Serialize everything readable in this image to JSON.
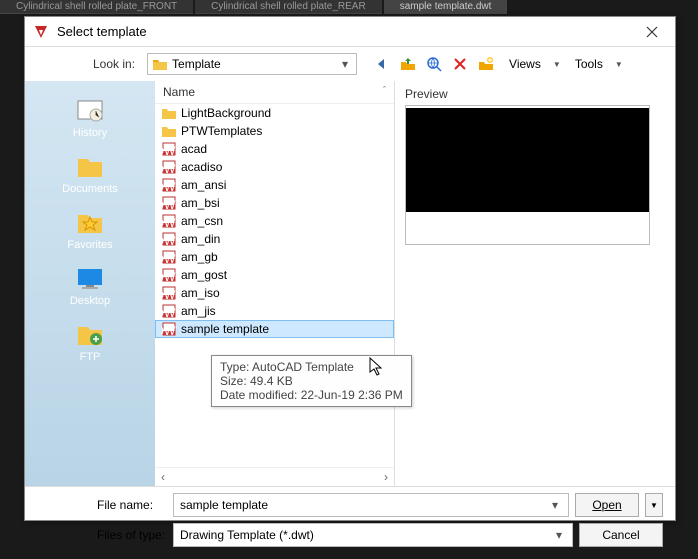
{
  "bg_tabs": [
    {
      "label": "Cylindrical shell rolled plate_FRONT",
      "active": false
    },
    {
      "label": "Cylindrical shell rolled plate_REAR",
      "active": false
    },
    {
      "label": "sample template.dwt",
      "active": true
    }
  ],
  "dialog": {
    "title": "Select template",
    "lookin_label": "Look in:",
    "lookin_value": "Template",
    "views_label": "Views",
    "tools_label": "Tools",
    "name_header": "Name",
    "preview_label": "Preview"
  },
  "sidebar": [
    {
      "label": "History",
      "icon": "history"
    },
    {
      "label": "Documents",
      "icon": "documents"
    },
    {
      "label": "Favorites",
      "icon": "favorites"
    },
    {
      "label": "Desktop",
      "icon": "desktop"
    },
    {
      "label": "FTP",
      "icon": "ftp"
    }
  ],
  "files": [
    {
      "name": "LightBackground",
      "type": "folder"
    },
    {
      "name": "PTWTemplates",
      "type": "folder"
    },
    {
      "name": "acad",
      "type": "dwt"
    },
    {
      "name": "acadiso",
      "type": "dwt"
    },
    {
      "name": "am_ansi",
      "type": "dwt"
    },
    {
      "name": "am_bsi",
      "type": "dwt"
    },
    {
      "name": "am_csn",
      "type": "dwt"
    },
    {
      "name": "am_din",
      "type": "dwt"
    },
    {
      "name": "am_gb",
      "type": "dwt"
    },
    {
      "name": "am_gost",
      "type": "dwt"
    },
    {
      "name": "am_iso",
      "type": "dwt"
    },
    {
      "name": "am_jis",
      "type": "dwt"
    },
    {
      "name": "sample template",
      "type": "dwt",
      "selected": true
    }
  ],
  "tooltip": {
    "type_line": "Type: AutoCAD Template",
    "size_line": "Size: 49.4 KB",
    "date_line": "Date modified: 22-Jun-19 2:36 PM"
  },
  "footer": {
    "filename_label": "File name:",
    "filename_value": "sample template",
    "filetype_label": "Files of type:",
    "filetype_value": "Drawing Template (*.dwt)",
    "open_label": "Open",
    "cancel_label": "Cancel"
  }
}
